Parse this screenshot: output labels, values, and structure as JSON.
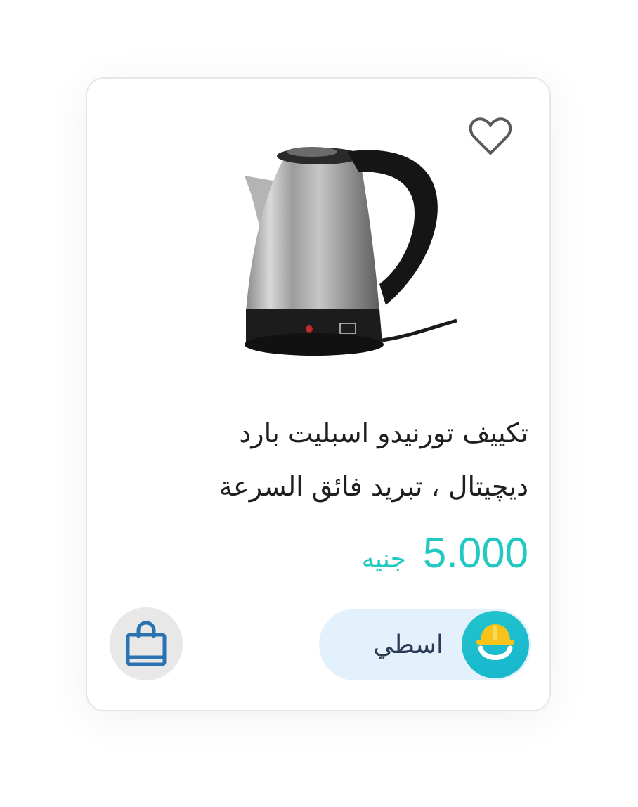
{
  "product": {
    "title_line1": "تكييف تورنيدو اسبليت بارد",
    "title_line2": "ديچيتال ، تبريد فائق السرعة",
    "price_value": "5.000",
    "price_currency": "جنيه"
  },
  "store": {
    "name": "اسطي"
  },
  "icons": {
    "favorite": "heart-outline-icon",
    "cart": "shopping-bag-icon",
    "store_logo": "helmet-smile-logo"
  },
  "colors": {
    "price": "#22c8c2",
    "store_pill_bg": "#e2f1fb",
    "store_name": "#2d3a55",
    "cart_btn_bg": "#e8e8e8",
    "cart_icon": "#2b72b0",
    "avatar_bg": "#1fbfcc",
    "helmet": "#f7c31b"
  }
}
